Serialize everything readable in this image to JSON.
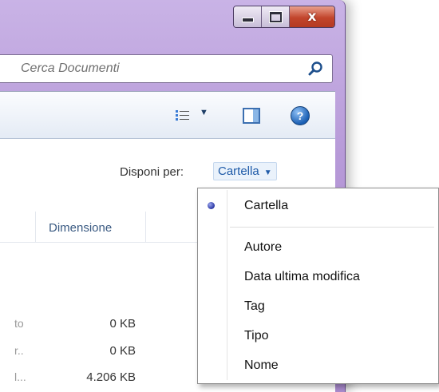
{
  "search": {
    "placeholder": "Cerca Documenti"
  },
  "toolbar": {
    "views_icon": "views-icon",
    "dropdown_arrow": "▼",
    "preview_icon": "preview-pane-icon",
    "help_label": "?"
  },
  "arrange": {
    "label": "Disponi per:",
    "value": "Cartella",
    "caret": "▼"
  },
  "columns": {
    "size": "Dimensione"
  },
  "rows": [
    {
      "name": "to",
      "size": "0 KB"
    },
    {
      "name": "r..",
      "size": "0 KB"
    },
    {
      "name": "l...",
      "size": "4.206 KB"
    }
  ],
  "menu": {
    "items": [
      {
        "label": "Cartella",
        "selected": true
      },
      {
        "label": "Autore"
      },
      {
        "label": "Data ultima modifica"
      },
      {
        "label": "Tag"
      },
      {
        "label": "Tipo"
      },
      {
        "label": "Nome"
      }
    ]
  },
  "window_controls": {
    "close": "x"
  }
}
